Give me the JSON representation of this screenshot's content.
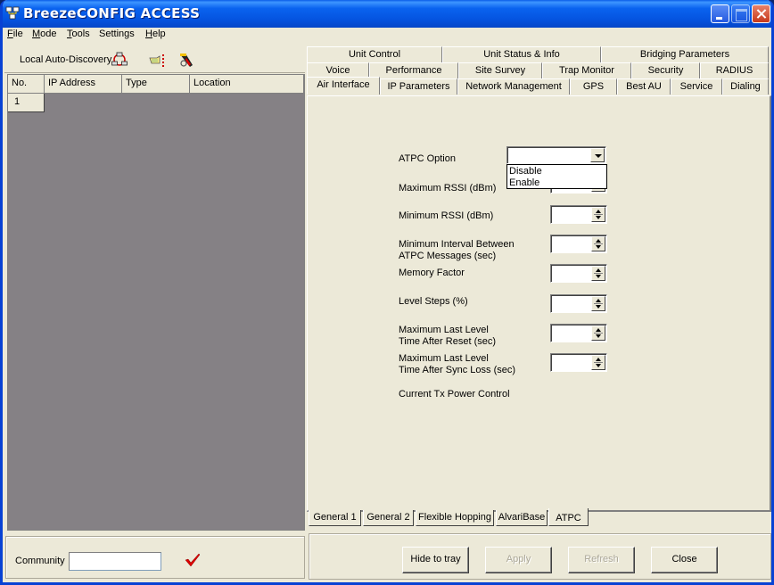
{
  "window": {
    "title": "BreezeCONFIG ACCESS",
    "controls": [
      "minimize",
      "maximize",
      "close"
    ]
  },
  "menu": [
    {
      "label": "File",
      "accel": "F"
    },
    {
      "label": "Mode",
      "accel": "M"
    },
    {
      "label": "Tools",
      "accel": "T"
    },
    {
      "label": "Settings",
      "accel": ""
    },
    {
      "label": "Help",
      "accel": "H"
    }
  ],
  "toolbar": {
    "auto_discovery_label": "Local Auto-Discovery",
    "icons": [
      "network-discovery-icon",
      "pointer-select-icon",
      "tools-icon"
    ]
  },
  "grid": {
    "columns": [
      "No.",
      "IP Address",
      "Type",
      "Location"
    ],
    "rows": [
      {
        "no": "1",
        "ip": "",
        "type": "",
        "location": ""
      }
    ]
  },
  "community": {
    "label": "Community",
    "value": ""
  },
  "tabs": {
    "row1": [
      "Unit Control",
      "Unit Status & Info",
      "Bridging Parameters"
    ],
    "row2": [
      "Voice",
      "Performance",
      "Site Survey",
      "Trap Monitor",
      "Security",
      "RADIUS"
    ],
    "row3": [
      "Air Interface",
      "IP Parameters",
      "Network Management",
      "GPS",
      "Best AU",
      "Service",
      "Dialing"
    ],
    "active": "Air Interface"
  },
  "atpc": {
    "option_label": "ATPC Option",
    "option_value": "",
    "dropdown_options": [
      "Disable",
      "Enable"
    ],
    "fields": [
      {
        "label1": "Maximum RSSI (dBm)",
        "label2": "",
        "value": ""
      },
      {
        "label1": "Minimum RSSI (dBm)",
        "label2": "",
        "value": ""
      },
      {
        "label1": "Minimum Interval Between",
        "label2": "ATPC Messages (sec)",
        "value": ""
      },
      {
        "label1": "Memory Factor",
        "label2": "",
        "value": ""
      },
      {
        "label1": "Level Steps (%)",
        "label2": "",
        "value": ""
      },
      {
        "label1": "Maximum Last Level",
        "label2": "Time After Reset (sec)",
        "value": ""
      },
      {
        "label1": "Maximum Last Level",
        "label2": "Time After Sync Loss (sec)",
        "value": ""
      }
    ],
    "current_tx_label": "Current Tx Power Control"
  },
  "subtabs": {
    "items": [
      "General 1",
      "General 2",
      "Flexible Hopping",
      "AlvariBase",
      "ATPC"
    ],
    "active": "ATPC"
  },
  "buttons": {
    "hide": "Hide to tray",
    "apply": "Apply",
    "refresh": "Refresh",
    "close": "Close"
  }
}
